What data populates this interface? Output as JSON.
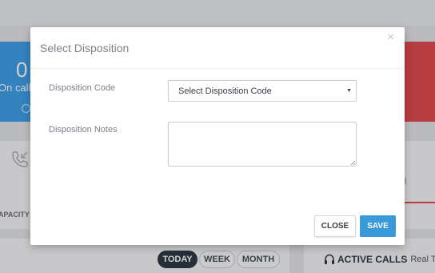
{
  "background": {
    "stat_blue": {
      "number": "0",
      "label": "On call"
    },
    "capacity_label": "APACITY",
    "range_tabs": {
      "today": "TODAY",
      "week": "WEEK",
      "month": "MONTH",
      "selected": "TODAY"
    },
    "active_calls": {
      "title": "ACTIVE CALLS",
      "subtitle": "Real Tim"
    }
  },
  "modal": {
    "title": "Select Disposition",
    "close_glyph": "×",
    "fields": {
      "code": {
        "label": "Disposition Code",
        "selected_value": "Select Disposition Code"
      },
      "notes": {
        "label": "Disposition Notes",
        "value": ""
      }
    },
    "buttons": {
      "close": "CLOSE",
      "save": "SAVE"
    }
  },
  "colors": {
    "accent": "#3a9ad9",
    "stat_blue": "#3f9fe8",
    "stat_red": "#e04b50",
    "pill_active": "#2f3a45"
  },
  "icons": [
    "phone-incoming-icon",
    "headset-icon",
    "close-icon",
    "caret-down-icon",
    "resize-grip-icon",
    "chevron-right-circle-icon"
  ]
}
